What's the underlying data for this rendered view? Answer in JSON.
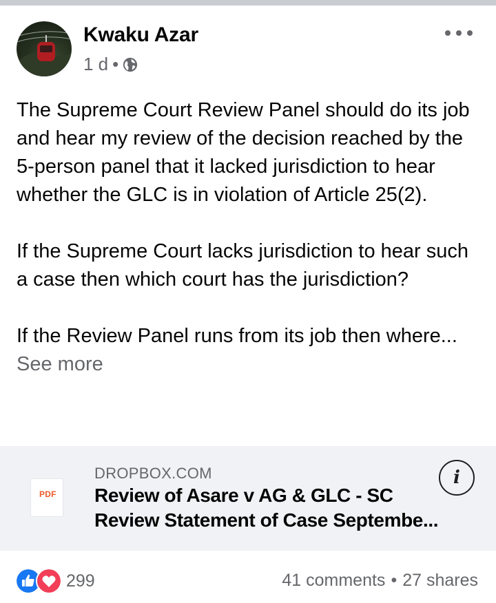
{
  "post": {
    "author": "Kwaku Azar",
    "time": "1 d",
    "dot": "•",
    "privacy_icon": "globe-icon",
    "more_icon": "more-horizontal-icon"
  },
  "content": {
    "paragraphs": [
      "The Supreme Court Review Panel should do its job and hear my review of the decision reached by the 5-person panel that it lacked jurisdiction to hear whether the GLC is in violation of Article 25(2).",
      "If the Supreme Court lacks jurisdiction to hear such a case then which court has the jurisdiction?",
      "If the Review Panel runs from its job then where..."
    ],
    "see_more": "See more"
  },
  "link_preview": {
    "domain": "DROPBOX.COM",
    "title": "Review of Asare v AG & GLC - SC Review Statement of Case Septembe...",
    "file_badge": "PDF",
    "info_label": "i"
  },
  "engagement": {
    "reaction_count": "299",
    "comments": "41 comments",
    "separator": "•",
    "shares": "27 shares",
    "reaction_icons": [
      "like-icon",
      "love-icon"
    ]
  },
  "colors": {
    "text_primary": "#050505",
    "text_secondary": "#65676b",
    "like_blue": "#1877f2",
    "love_red": "#f33e58",
    "card_bg": "#f0f2f5",
    "pdf_orange": "#f05a28"
  }
}
